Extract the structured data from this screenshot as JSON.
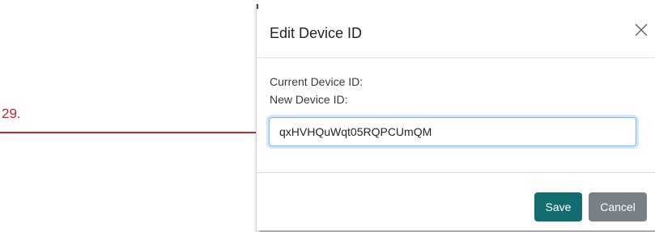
{
  "annotation": {
    "label": "29.",
    "color": "#c0282d"
  },
  "modal": {
    "title": "Edit Device ID",
    "close_icon": "close-icon",
    "current_device_label": "Current Device ID:",
    "new_device_label": "New Device ID:",
    "new_device_value": "qxHVHQuWqt05RQPCUmQM",
    "save_label": "Save",
    "cancel_label": "Cancel",
    "colors": {
      "save": "#126d70",
      "cancel": "#7a8088",
      "focus_border": "#86b7fe"
    }
  }
}
